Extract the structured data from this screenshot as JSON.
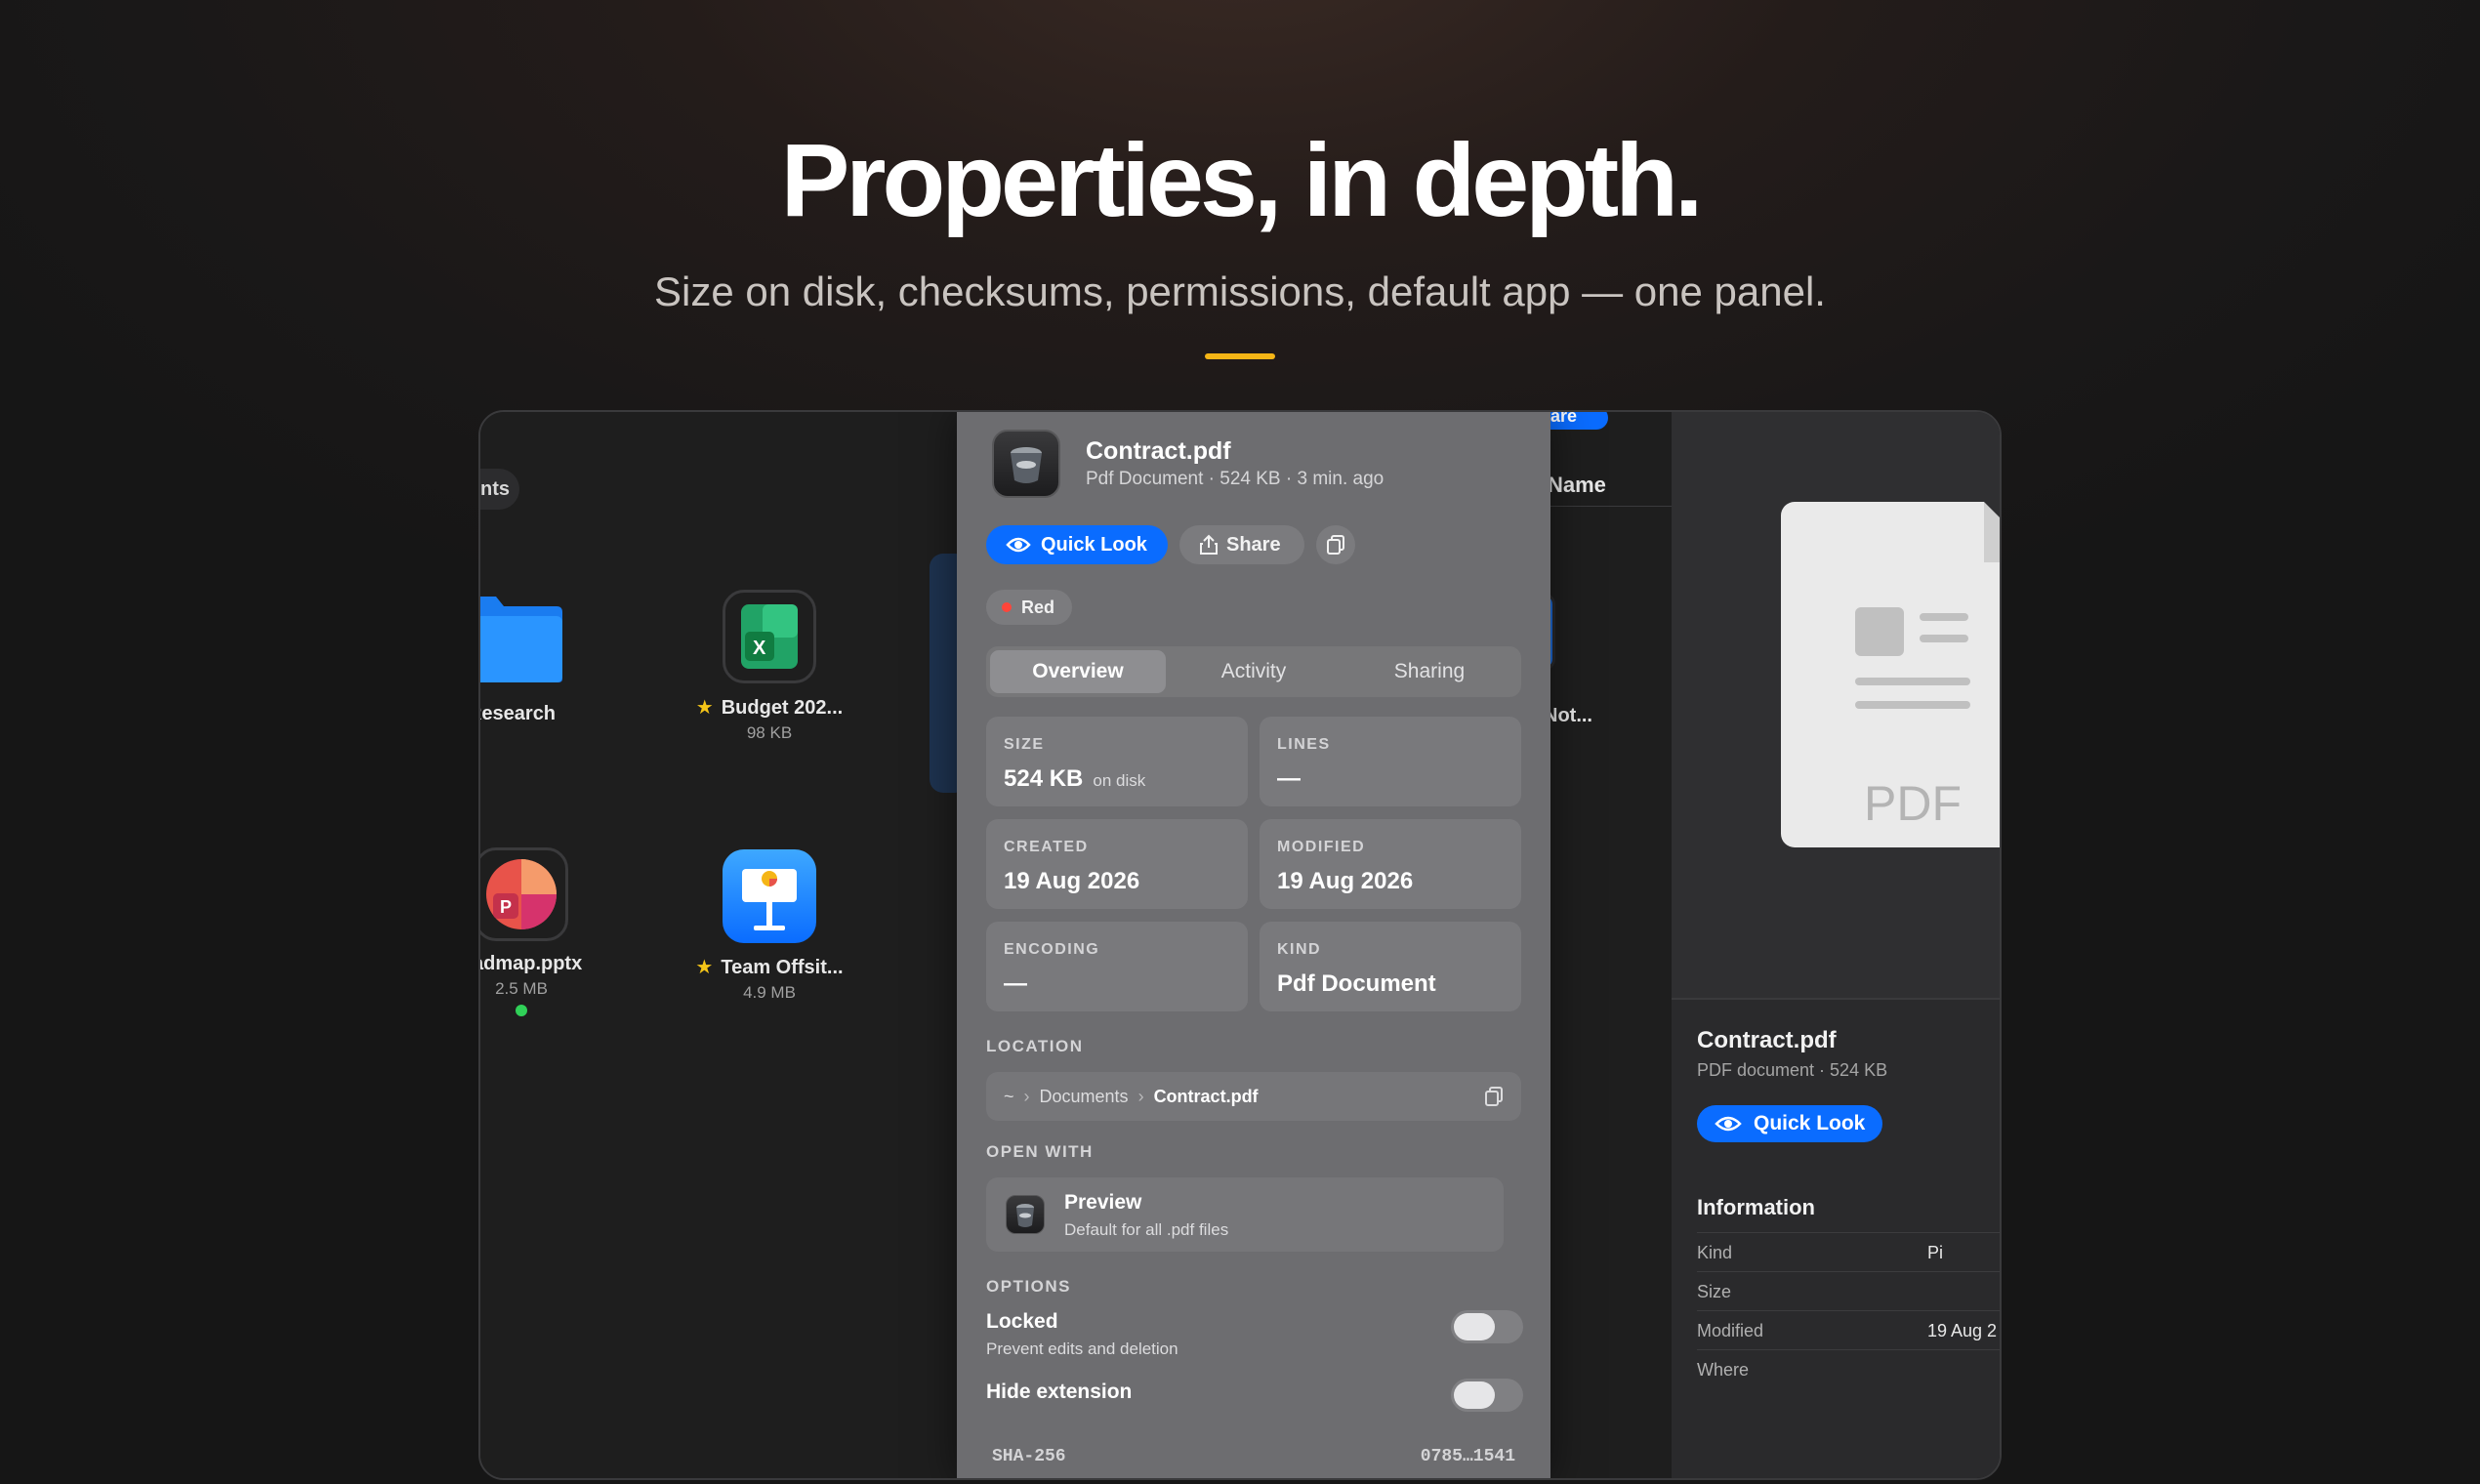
{
  "hero": {
    "title": "Properties, in depth.",
    "subtitle": "Size on disk, checksums, permissions, default app — one panel."
  },
  "finder": {
    "tab_fragment": "nts",
    "items": [
      {
        "name": "Research",
        "size": "",
        "starred": false,
        "icon": "folder-icon"
      },
      {
        "name": "Budget 202...",
        "size": "98 KB",
        "starred": true,
        "icon": "excel-icon"
      },
      {
        "name": "oadmap.pptx",
        "size": "2.5 MB",
        "starred": false,
        "icon": "powerpoint-icon",
        "tag_color": "#30d158"
      },
      {
        "name": "Team Offsit...",
        "size": "4.9 MB",
        "starred": true,
        "icon": "keynote-icon"
      }
    ],
    "list_header": "Name",
    "list_item": "Not...",
    "top_button_fragment": "hare"
  },
  "panel": {
    "file_name": "Contract.pdf",
    "file_meta": "Pdf Document · 524 KB · 3 min. ago",
    "quick_look_label": "Quick Look",
    "share_label": "Share",
    "tag_label": "Red",
    "tag_color": "#ff453a",
    "tabs": [
      "Overview",
      "Activity",
      "Sharing"
    ],
    "active_tab": "Overview",
    "cards": {
      "size": {
        "label": "SIZE",
        "value": "524 KB",
        "unit": "on disk"
      },
      "lines": {
        "label": "LINES",
        "value": "—"
      },
      "created": {
        "label": "CREATED",
        "value": "19 Aug 2026"
      },
      "modified": {
        "label": "MODIFIED",
        "value": "19 Aug 2026"
      },
      "encoding": {
        "label": "ENCODING",
        "value": "—"
      },
      "kind": {
        "label": "KIND",
        "value": "Pdf Document"
      }
    },
    "location": {
      "label": "LOCATION",
      "crumbs": [
        "~",
        "Documents",
        "Contract.pdf"
      ]
    },
    "open_with": {
      "label": "OPEN WITH",
      "app": "Preview",
      "desc": "Default for all .pdf files"
    },
    "options": {
      "label": "OPTIONS",
      "locked_label": "Locked",
      "locked_desc": "Prevent edits and deletion",
      "locked_on": false,
      "hide_ext_label": "Hide extension",
      "hide_ext_on": false
    },
    "checksum": {
      "label": "SHA-256",
      "value": "0785…1541"
    }
  },
  "preview": {
    "doc_label": "PDF",
    "file_name": "Contract.pdf",
    "file_meta": "PDF document · 524 KB",
    "quick_look_label": "Quick Look",
    "info_title": "Information",
    "rows": [
      {
        "label": "Kind",
        "value": "Pi"
      },
      {
        "label": "Size",
        "value": ""
      },
      {
        "label": "Modified",
        "value": "19 Aug 2"
      },
      {
        "label": "Where",
        "value": ""
      }
    ]
  },
  "colors": {
    "accent": "#0a6cff",
    "hero_bar": "#f5b516",
    "star": "#f5c518"
  }
}
